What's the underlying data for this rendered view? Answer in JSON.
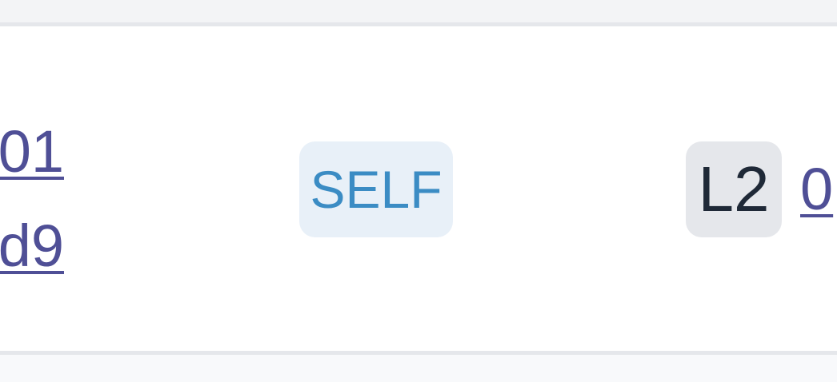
{
  "row": {
    "hash_line_1": "01",
    "hash_line_2": "d9",
    "source_badge": "SELF",
    "level_badge": "L2",
    "level_link": "0"
  },
  "colors": {
    "link": "#4f4f96",
    "self_badge_bg": "#e8f0f8",
    "self_badge_text": "#3b8cc4",
    "level_badge_bg": "#e5e7eb",
    "level_badge_text": "#1f2937",
    "border": "#e5e7eb"
  }
}
